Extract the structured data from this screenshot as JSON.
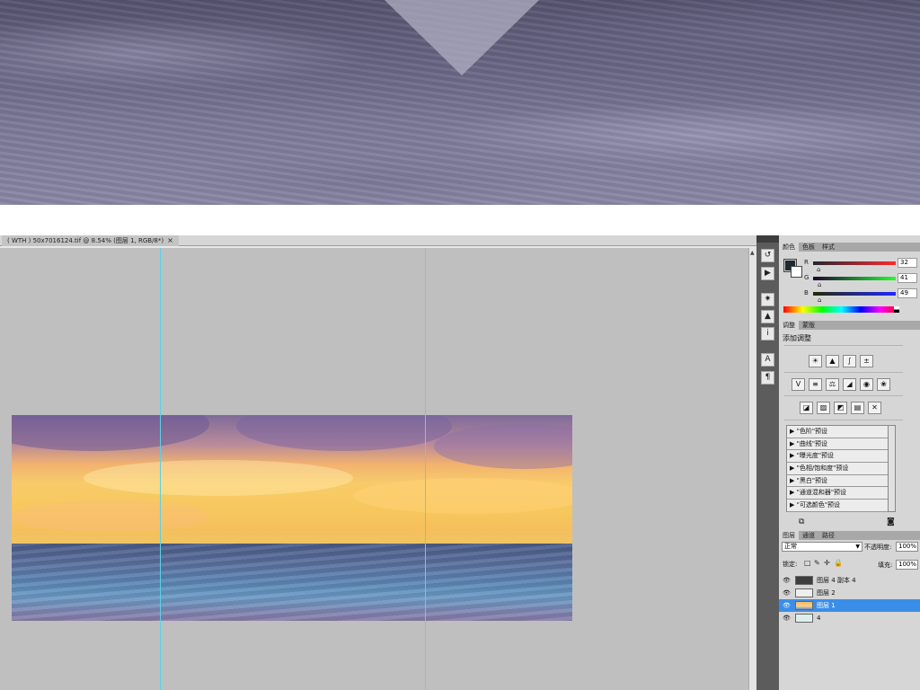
{
  "document": {
    "tab_title": "( WTH ) 50x7016124.tif @ 8.54% (图层 1, RGB/8*)",
    "tab_close": "×"
  },
  "color_panel": {
    "tabs": [
      "颜色",
      "色板",
      "样式"
    ],
    "foreground": "#202931",
    "background": "#ffffff",
    "channels": [
      {
        "label": "R",
        "value": "32"
      },
      {
        "label": "G",
        "value": "41"
      },
      {
        "label": "B",
        "value": "49"
      }
    ]
  },
  "adjustments_panel": {
    "tabs": [
      "调整",
      "蒙版"
    ],
    "title": "添加调整",
    "presets": [
      "\"色阶\"预设",
      "\"曲线\"预设",
      "\"曝光度\"预设",
      "\"色相/饱和度\"预设",
      "\"黑白\"预设",
      "\"通道混和器\"预设",
      "\"可选颜色\"预设"
    ]
  },
  "layers_panel": {
    "tabs": [
      "图层",
      "通道",
      "路径"
    ],
    "blend_mode": "正常",
    "opacity_label": "不透明度:",
    "opacity_value": "100%",
    "lock_label": "锁定:",
    "fill_label": "填充:",
    "fill_value": "100%",
    "layers": [
      {
        "name": "图层 4 副本 4",
        "selected": false
      },
      {
        "name": "图层 2",
        "selected": false
      },
      {
        "name": "图层 1",
        "selected": true
      },
      {
        "name": "4",
        "selected": false
      }
    ]
  },
  "colors": {
    "guide": "#59d2e6",
    "selection": "#3b8ee8",
    "canvas": "#bfbfbf"
  },
  "icons": {
    "dock_tools": [
      "history-icon",
      "actions-icon",
      "navigator-icon",
      "histogram-icon",
      "info-icon",
      "character-icon",
      "paragraph-icon"
    ],
    "adjustment_rows": [
      [
        "brightness-icon",
        "levels-icon",
        "curves-icon",
        "exposure-icon"
      ],
      [
        "vibrance-icon",
        "hue-saturation-icon",
        "color-balance-icon",
        "black-white-icon",
        "photo-filter-icon",
        "channel-mixer-icon"
      ],
      [
        "invert-icon",
        "posterize-icon",
        "threshold-icon",
        "gradient-map-icon",
        "selective-color-icon"
      ]
    ]
  }
}
